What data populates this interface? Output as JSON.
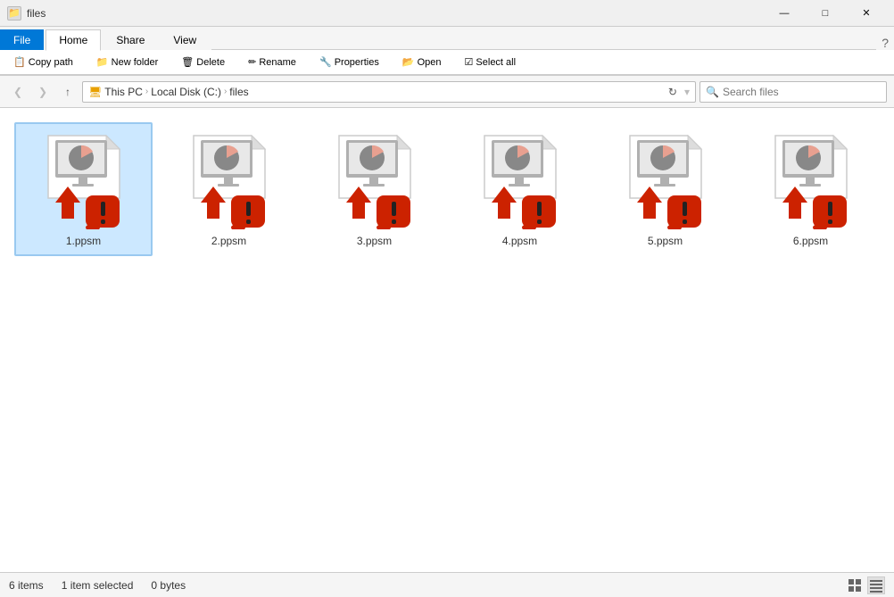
{
  "titleBar": {
    "title": "files",
    "minLabel": "—",
    "maxLabel": "□",
    "closeLabel": "✕"
  },
  "ribbon": {
    "tabs": [
      "File",
      "Home",
      "Share",
      "View"
    ],
    "activeTab": "Home"
  },
  "navBar": {
    "backLabel": "❮",
    "forwardLabel": "❯",
    "upLabel": "↑",
    "breadcrumbs": [
      "This PC",
      "Local Disk (C:)",
      "files"
    ],
    "searchPlaceholder": "Search files"
  },
  "files": [
    {
      "id": 1,
      "name": "1.ppsm",
      "selected": true
    },
    {
      "id": 2,
      "name": "2.ppsm",
      "selected": false
    },
    {
      "id": 3,
      "name": "3.ppsm",
      "selected": false
    },
    {
      "id": 4,
      "name": "4.ppsm",
      "selected": false
    },
    {
      "id": 5,
      "name": "5.ppsm",
      "selected": false
    },
    {
      "id": 6,
      "name": "6.ppsm",
      "selected": false
    }
  ],
  "statusBar": {
    "itemCount": "6 items",
    "selectedInfo": "1 item selected",
    "sizeInfo": "0 bytes"
  }
}
